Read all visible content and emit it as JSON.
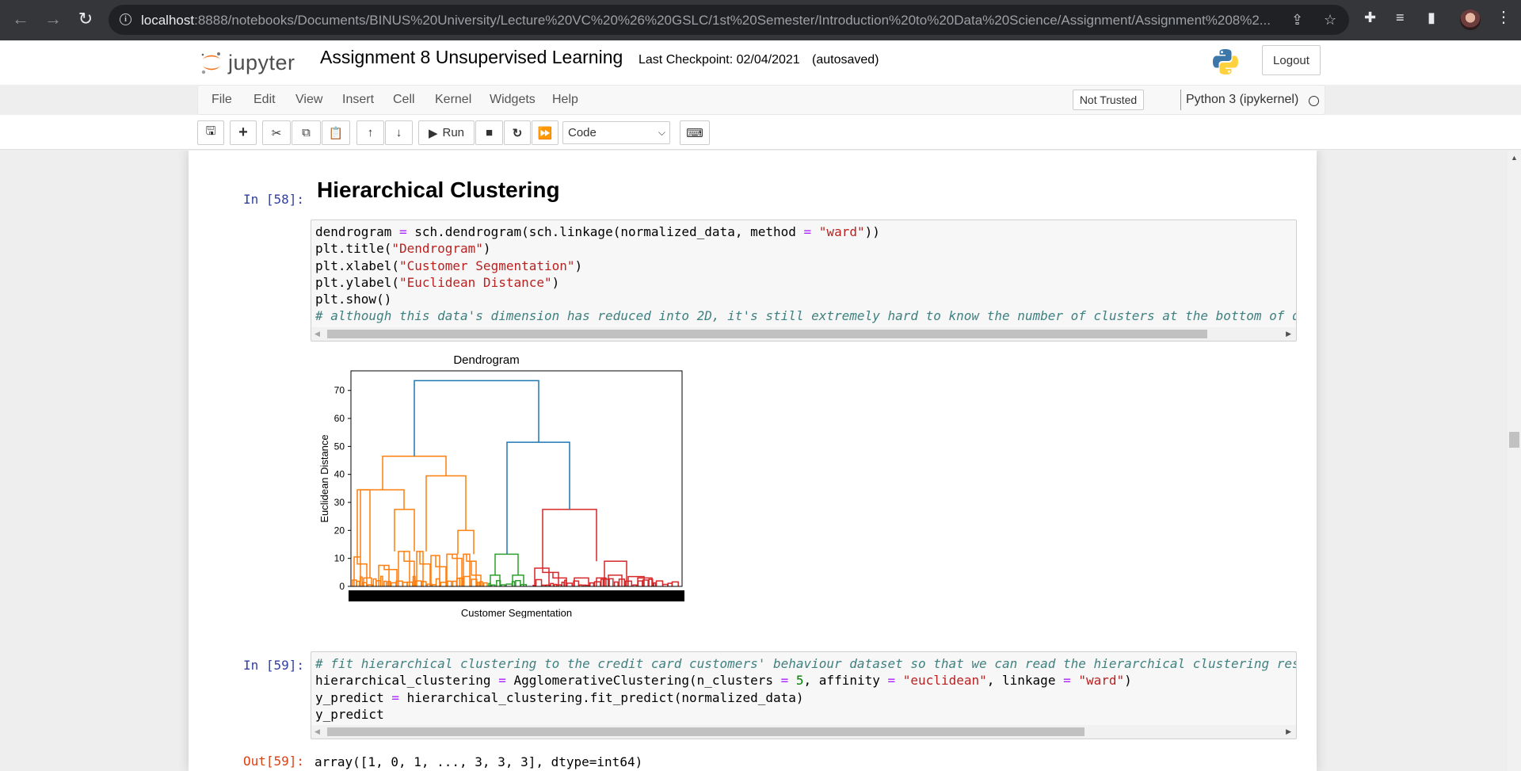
{
  "browser": {
    "url_host": "localhost",
    "url_rest": ":8888/notebooks/Documents/BINUS%20University/Lecture%20VC%20%26%20GSLC/1st%20Semester/Introduction%20to%20Data%20Science/Assignment/Assignment%208%2..."
  },
  "header": {
    "logo_text": "jupyter",
    "notebook_title": "Assignment 8 Unsupervised Learning",
    "checkpoint": "Last Checkpoint: 02/04/2021",
    "autosaved": "(autosaved)",
    "logout_label": "Logout"
  },
  "menubar": {
    "items": [
      "File",
      "Edit",
      "View",
      "Insert",
      "Cell",
      "Kernel",
      "Widgets",
      "Help"
    ],
    "not_trusted": "Not Trusted",
    "kernel_name": "Python 3 (ipykernel)"
  },
  "toolbar": {
    "run_label": "Run",
    "cell_type": "Code"
  },
  "cells": {
    "heading": "Hierarchical Clustering",
    "cell58_prompt": "In [58]:",
    "cell58_lines": [
      "dendrogram = sch.dendrogram(sch.linkage(normalized_data, method = \"ward\"))",
      "plt.title(\"Dendrogram\")",
      "plt.xlabel(\"Customer Segmentation\")",
      "plt.ylabel(\"Euclidean Distance\")",
      "plt.show()",
      "# although this data's dimension has reduced into 2D, it's still extremely hard to know the number of clusters at the bottom of d"
    ],
    "cell59_prompt": "In [59]:",
    "cell59_lines": [
      "# fit hierarchical clustering to the credit card customers' behaviour dataset so that we can read the hierarchical clustering res",
      "hierarchical_clustering = AgglomerativeClustering(n_clusters = 5, affinity = \"euclidean\", linkage = \"ward\")",
      "y_predict = hierarchical_clustering.fit_predict(normalized_data)",
      "y_predict"
    ],
    "out59_prompt": "Out[59]:",
    "out59_text": "array([1, 0, 1, ..., 3, 3, 3], dtype=int64)"
  },
  "chart_data": {
    "type": "dendrogram",
    "title": "Dendrogram",
    "xlabel": "Customer Segmentation",
    "ylabel": "Euclidean Distance",
    "ylim": [
      0,
      77
    ],
    "yticks": [
      0,
      10,
      20,
      30,
      40,
      50,
      60,
      70
    ],
    "grid": false,
    "colors": {
      "top": "#1f77b4",
      "cluster_orange": "#ff7f0e",
      "cluster_green": "#2ca02c",
      "cluster_red": "#d62728"
    },
    "top_links": [
      {
        "height": 73.5,
        "joins": [
          "orange_cluster",
          "right_group"
        ],
        "color": "#1f77b4"
      },
      {
        "height": 51.5,
        "joins": [
          "green_cluster",
          "red_cluster"
        ],
        "color": "#1f77b4"
      }
    ],
    "clusters": [
      {
        "name": "orange_cluster",
        "root_height": 46.5,
        "sub_heights": [
          34.5,
          39.5,
          27.5,
          20
        ],
        "color": "#ff7f0e"
      },
      {
        "name": "green_cluster",
        "root_height": 11.5,
        "sub_heights": [
          4
        ],
        "color": "#2ca02c"
      },
      {
        "name": "red_cluster",
        "root_height": 27.5,
        "sub_heights": [
          9,
          6.5
        ],
        "color": "#d62728"
      }
    ]
  }
}
